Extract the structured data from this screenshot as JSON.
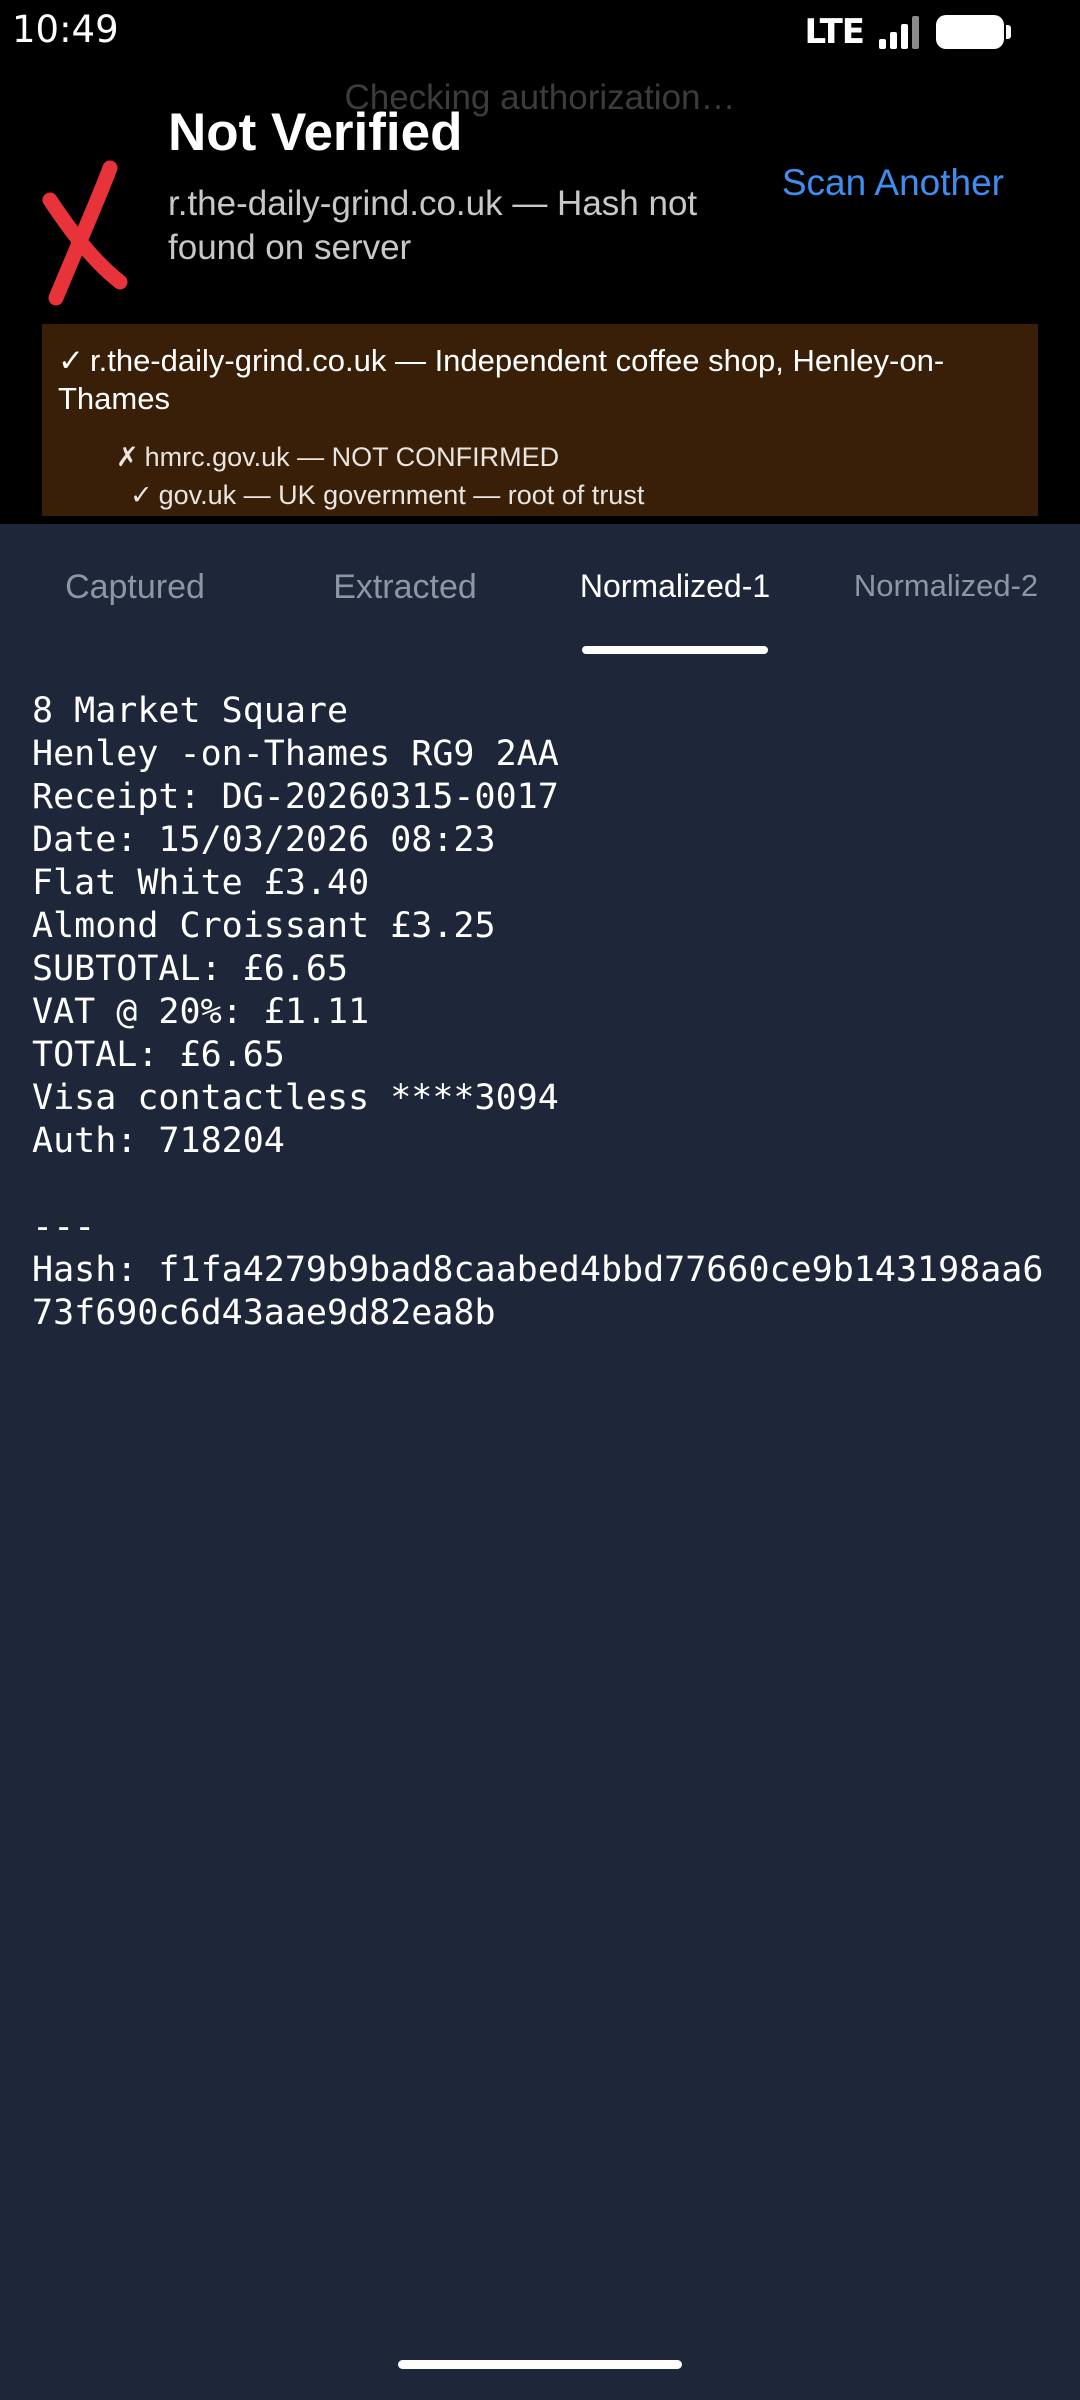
{
  "status_bar": {
    "time": "10:49",
    "network": "LTE"
  },
  "header": {
    "checking_text": "Checking authorization…",
    "title": "Not Verified",
    "detail": "r.the-daily-grind.co.uk — Hash not found on server",
    "scan_another_label": "Scan Another",
    "fail_color": "#e8333a"
  },
  "trust_chain": {
    "main": {
      "mark": "✓",
      "text": "r.the-daily-grind.co.uk — Independent coffee shop, Henley-on-Thames"
    },
    "items": [
      {
        "mark": "✗",
        "text": "hmrc.gov.uk — NOT CONFIRMED"
      },
      {
        "mark": "✓",
        "text": "gov.uk — UK government — root of trust"
      }
    ]
  },
  "tabs": [
    {
      "label": "Captured",
      "active": false
    },
    {
      "label": "Extracted",
      "active": false
    },
    {
      "label": "Normalized-1",
      "active": true
    },
    {
      "label": "Normalized-2",
      "active": false
    }
  ],
  "receipt": {
    "lines": [
      "8 Market Square",
      "Henley -on-Thames RG9 2AA",
      "Receipt: DG-20260315-0017",
      "Date: 15/03/2026 08:23",
      "Flat White £3.40",
      "Almond Croissant £3.25",
      "SUBTOTAL: £6.65",
      "VAT @ 20%: £1.11",
      "TOTAL: £6.65",
      "Visa contactless ****3094",
      "Auth: 718204",
      "",
      "---",
      "Hash: f1fa4279b9bad8caabed4bbd77660ce9b143198aa673f690c6d43aae9d82ea8b"
    ]
  }
}
